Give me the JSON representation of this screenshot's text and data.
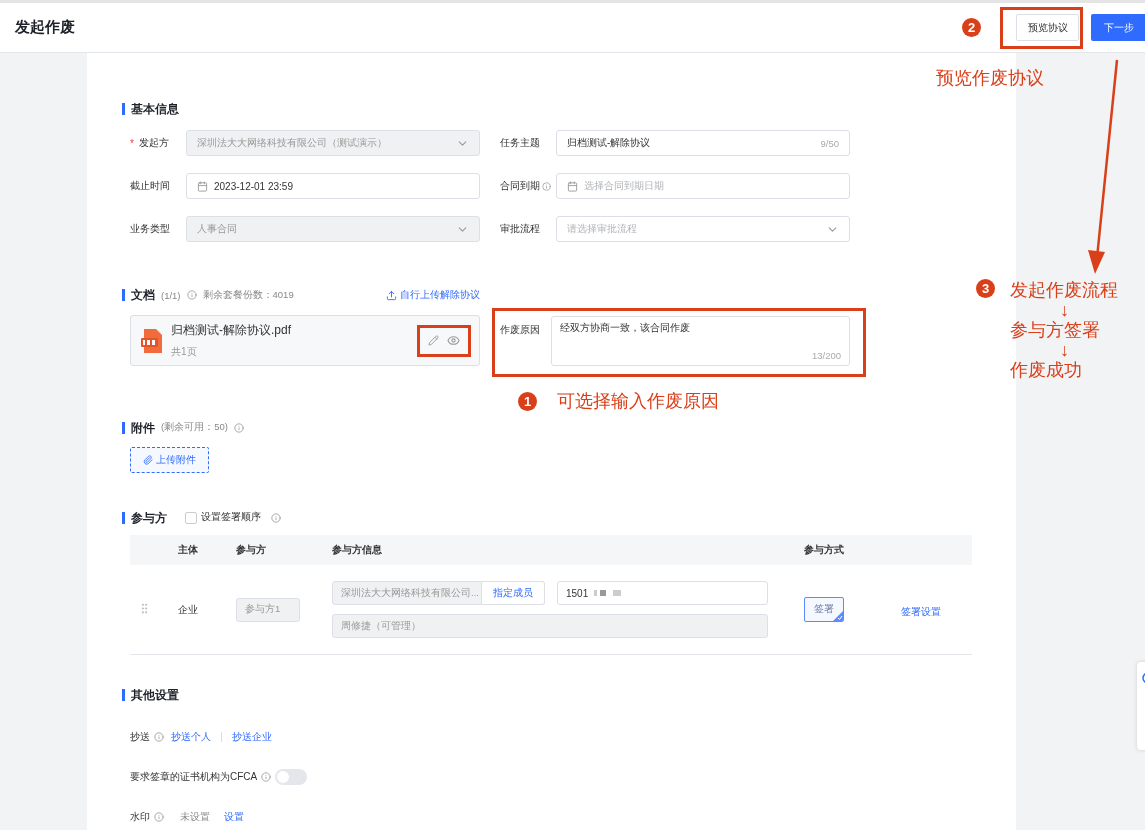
{
  "header": {
    "title": "发起作废",
    "buttons": [
      {
        "label": "预览协议",
        "kind": "secondary",
        "highlighted": true
      },
      {
        "label": "下一步",
        "kind": "primary",
        "highlighted": false
      }
    ]
  },
  "basic_info": {
    "title": "基本信息",
    "fields": [
      {
        "label": "发起方",
        "required_mark": "*",
        "kind": "select",
        "value": "深圳法大大网络科技有限公司（测试演示）",
        "disabled": true
      },
      {
        "label": "任务主题",
        "kind": "input",
        "value": "归档测试-解除协议",
        "counter": "9/50",
        "disabled": false
      },
      {
        "label": "截止时间",
        "kind": "date",
        "value": "2023-12-01 23:59",
        "disabled": false
      },
      {
        "label": "合同到期",
        "info": true,
        "kind": "date",
        "placeholder": "选择合同到期日期",
        "disabled": false
      },
      {
        "label": "业务类型",
        "kind": "select",
        "value": "人事合同",
        "disabled": true
      },
      {
        "label": "审批流程",
        "kind": "select",
        "placeholder": "请选择审批流程",
        "disabled": false
      }
    ]
  },
  "documents": {
    "title": "文档",
    "count": "(1/1)",
    "quota": "剩余套餐份数：4019",
    "upload_link": "自行上传解除协议",
    "files": [
      {
        "name": "归档测试-解除协议.pdf",
        "pages": "共1页",
        "kind": "pdf",
        "actions_highlighted": true
      }
    ],
    "reason": {
      "label": "作废原因",
      "value": "经双方协商一致，该合同作废",
      "counter": "13/200",
      "highlighted": true
    }
  },
  "attachments": {
    "title": "附件",
    "note": "(剩余可用：50)",
    "upload_button": "上传附件"
  },
  "participants": {
    "title": "参与方",
    "order_checkbox": {
      "label": "设置签署顺序",
      "checked": false
    },
    "columns": [
      "主体",
      "参与方",
      "参与方信息",
      "参与方式"
    ],
    "rows": [
      {
        "subject": "企业",
        "name": "参与方1",
        "company": "深圳法大大网络科技有限公司...",
        "member_button": "指定成员",
        "phone": "1501",
        "member": "周修捷（可管理）",
        "mode": {
          "label": "签署",
          "selected": true
        },
        "action": "签署设置"
      }
    ]
  },
  "other_settings": {
    "title": "其他设置",
    "rows": [
      {
        "kind": "links",
        "label": "抄送",
        "info": true,
        "links": [
          "抄送个人",
          "抄送企业"
        ]
      },
      {
        "kind": "toggle",
        "label": "要求签章的证书机构为CFCA",
        "info": true,
        "on": false
      },
      {
        "kind": "status",
        "label": "水印",
        "info": true,
        "value": "未设置",
        "link": "设置"
      }
    ]
  },
  "annotations": {
    "preview": {
      "number": "2",
      "text": "预览作废协议"
    },
    "reason": {
      "number": "1",
      "text": "可选择输入作废原因"
    },
    "flow": {
      "number": "3",
      "steps": [
        "发起作废流程",
        "↓",
        "参与方签署",
        "↓",
        "作废成功"
      ]
    }
  }
}
